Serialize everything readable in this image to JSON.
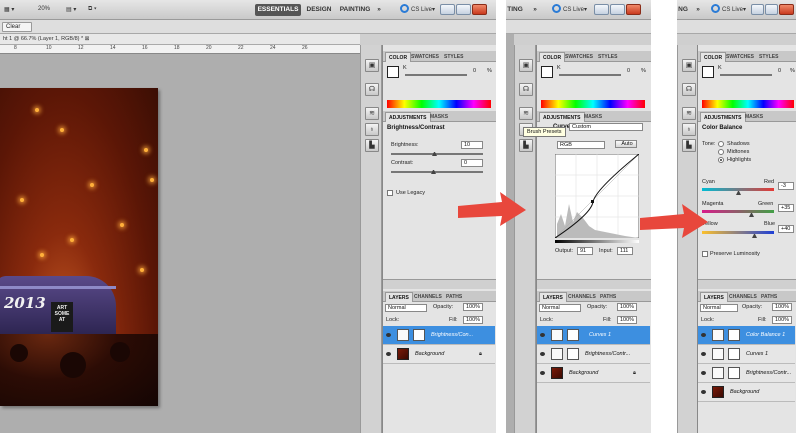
{
  "shot1": {
    "top": {
      "zoom": "20%",
      "essentials": "ESSENTIALS",
      "design": "DESIGN",
      "painting": "PAINTING",
      "more": "»",
      "cslive": "CS Live▾"
    },
    "clear": "Clear",
    "doc_tab": "ht 1 @ 66.7% (Layer 1, RGB/8) * ⊠",
    "ruler": [
      "8",
      "10",
      "12",
      "14",
      "16",
      "18",
      "20",
      "22",
      "24",
      "26"
    ],
    "photo_text": {
      "year": "2013",
      "sign": "ART\nSOME\nAT"
    },
    "color_panel": {
      "tabs": [
        "COLOR",
        "SWATCHES",
        "STYLES"
      ],
      "k_label": "K",
      "k_value": "0",
      "k_unit": "%"
    },
    "adjustments": {
      "tabs": [
        "ADJUSTMENTS",
        "MASKS"
      ],
      "title": "Brightness/Contrast",
      "brightness_label": "Brightness:",
      "brightness_value": "10",
      "contrast_label": "Contrast:",
      "contrast_value": "0",
      "legacy_label": "Use Legacy"
    },
    "layers": {
      "tabs": [
        "LAYERS",
        "CHANNELS",
        "PATHS"
      ],
      "blend": "Normal",
      "opacity_label": "Opacity:",
      "opacity": "100%",
      "lock_label": "Lock:",
      "fill_label": "Fill:",
      "fill": "100%",
      "items": [
        "Brightness/Con...",
        "Background"
      ]
    }
  },
  "shot2": {
    "top": {
      "prefix": "TING",
      "more": "»",
      "cslive": "CS Live▾"
    },
    "color_panel": {
      "tabs": [
        "COLOR",
        "SWATCHES",
        "STYLES"
      ],
      "k_label": "K",
      "k_value": "0",
      "k_unit": "%"
    },
    "adjustments": {
      "tabs": [
        "ADJUSTMENTS",
        "MASKS"
      ],
      "preset_label": "Curves",
      "preset_value": "Custom",
      "channel": "RGB",
      "auto": "Auto",
      "output_label": "Output:",
      "output_value": "91",
      "input_label": "Input:",
      "input_value": "111"
    },
    "tooltip": "Brush Presets",
    "layers": {
      "tabs": [
        "LAYERS",
        "CHANNELS",
        "PATHS"
      ],
      "blend": "Normal",
      "opacity_label": "Opacity:",
      "opacity": "100%",
      "lock_label": "Lock:",
      "fill_label": "Fill:",
      "fill": "100%",
      "items": [
        "Curves 1",
        "Brightness/Contr...",
        "Background"
      ]
    }
  },
  "shot3": {
    "top": {
      "prefix": "NG",
      "more": "»",
      "cslive": "CS Live▾"
    },
    "color_panel": {
      "tabs": [
        "COLOR",
        "SWATCHES",
        "STYLES"
      ],
      "k_label": "K",
      "k_value": "0",
      "k_unit": "%"
    },
    "adjustments": {
      "tabs": [
        "ADJUSTMENTS",
        "MASKS"
      ],
      "title": "Color Balance",
      "tone_label": "Tone:",
      "tones": [
        "Shadows",
        "Midtones",
        "Highlights"
      ],
      "cyan": "Cyan",
      "red": "Red",
      "cyan_red_value": "-3",
      "magenta": "Magenta",
      "green": "Green",
      "magenta_green_value": "+35",
      "yellow": "Yellow",
      "blue": "Blue",
      "yellow_blue_value": "+40",
      "preserve_label": "Preserve Luminosity"
    },
    "layers": {
      "tabs": [
        "LAYERS",
        "CHANNELS",
        "PATHS"
      ],
      "blend": "Normal",
      "opacity_label": "Opacity:",
      "opacity": "100%",
      "lock_label": "Lock:",
      "fill_label": "Fill:",
      "fill": "100%",
      "items": [
        "Color Balance 1",
        "Curves 1",
        "Brightness/Contr...",
        "Background"
      ]
    }
  },
  "colors": {
    "arrow": "#e8473c",
    "selected_layer": "#3d8fe0"
  }
}
